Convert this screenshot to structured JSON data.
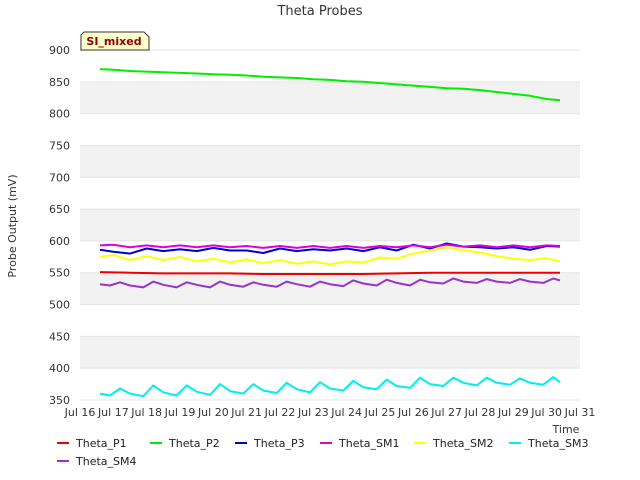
{
  "chart_data": {
    "type": "line",
    "title": "Theta Probes",
    "xlabel": "Time",
    "ylabel": "Probe Output (mV)",
    "badge": "SI_mixed",
    "ylim": [
      350,
      900
    ],
    "yticks": [
      350,
      400,
      450,
      500,
      550,
      600,
      650,
      700,
      750,
      800,
      850,
      900
    ],
    "xlim": [
      16,
      31
    ],
    "xticks": [
      16,
      17,
      18,
      19,
      20,
      21,
      22,
      23,
      24,
      25,
      26,
      27,
      28,
      29,
      30,
      31
    ],
    "xtick_labels": [
      "Jul 16",
      "Jul 17",
      "Jul 18",
      "Jul 19",
      "Jul 20",
      "Jul 21",
      "Jul 22",
      "Jul 23",
      "Jul 24",
      "Jul 25",
      "Jul 26",
      "Jul 27",
      "Jul 28",
      "Jul 29",
      "Jul 30",
      "Jul 31"
    ],
    "grid": "horizontal bands",
    "legend_position": "bottom",
    "series": [
      {
        "name": "Theta_P1",
        "color": "#ee0000",
        "x": [
          16.6,
          17.5,
          18.5,
          19.5,
          20.5,
          21.5,
          22.5,
          23.5,
          24.5,
          25.5,
          26.5,
          27.5,
          28.5,
          29.5,
          30.4
        ],
        "y": [
          551,
          550,
          549,
          549,
          549,
          548,
          548,
          548,
          548,
          549,
          550,
          550,
          550,
          550,
          550
        ]
      },
      {
        "name": "Theta_P2",
        "color": "#00ee00",
        "x": [
          16.6,
          17.0,
          17.5,
          18.0,
          18.5,
          19.0,
          19.5,
          20.0,
          20.5,
          21.0,
          21.5,
          22.0,
          22.5,
          23.0,
          23.5,
          24.0,
          24.5,
          25.0,
          25.5,
          26.0,
          26.5,
          27.0,
          27.5,
          28.0,
          28.5,
          29.0,
          29.5,
          30.0,
          30.4
        ],
        "y": [
          870,
          869,
          867,
          866,
          865,
          864,
          863,
          862,
          861,
          860,
          858,
          857,
          856,
          854,
          853,
          851,
          850,
          848,
          846,
          844,
          842,
          840,
          839,
          837,
          834,
          831,
          828,
          823,
          821
        ]
      },
      {
        "name": "Theta_P3",
        "color": "#0000cc",
        "x": [
          16.6,
          17.0,
          17.5,
          18.0,
          18.5,
          19.0,
          19.5,
          20.0,
          20.5,
          21.0,
          21.5,
          22.0,
          22.5,
          23.0,
          23.5,
          24.0,
          24.5,
          25.0,
          25.5,
          26.0,
          26.5,
          27.0,
          27.5,
          28.0,
          28.5,
          29.0,
          29.5,
          30.0,
          30.4
        ],
        "y": [
          586,
          583,
          580,
          588,
          584,
          587,
          584,
          589,
          585,
          585,
          581,
          588,
          584,
          587,
          585,
          588,
          584,
          590,
          585,
          594,
          588,
          596,
          591,
          590,
          588,
          590,
          586,
          592,
          591
        ]
      },
      {
        "name": "Theta_SM1",
        "color": "#dd00dd",
        "x": [
          16.6,
          17.0,
          17.5,
          18.0,
          18.5,
          19.0,
          19.5,
          20.0,
          20.5,
          21.0,
          21.5,
          22.0,
          22.5,
          23.0,
          23.5,
          24.0,
          24.5,
          25.0,
          25.5,
          26.0,
          26.5,
          27.0,
          27.5,
          28.0,
          28.5,
          29.0,
          29.5,
          30.0,
          30.4
        ],
        "y": [
          593,
          594,
          590,
          593,
          590,
          593,
          590,
          593,
          590,
          592,
          589,
          592,
          589,
          592,
          589,
          592,
          589,
          592,
          590,
          593,
          590,
          594,
          591,
          593,
          590,
          593,
          590,
          593,
          592
        ]
      },
      {
        "name": "Theta_SM2",
        "color": "#ffff00",
        "x": [
          16.6,
          17.0,
          17.5,
          18.0,
          18.5,
          19.0,
          19.5,
          20.0,
          20.5,
          21.0,
          21.5,
          22.0,
          22.5,
          23.0,
          23.5,
          24.0,
          24.5,
          25.0,
          25.5,
          26.0,
          26.5,
          27.0,
          27.5,
          28.0,
          28.5,
          29.0,
          29.5,
          30.0,
          30.4
        ],
        "y": [
          575,
          578,
          570,
          576,
          570,
          575,
          568,
          572,
          566,
          571,
          565,
          570,
          564,
          568,
          563,
          568,
          566,
          574,
          572,
          580,
          585,
          590,
          585,
          582,
          576,
          572,
          570,
          573,
          568
        ]
      },
      {
        "name": "Theta_SM3",
        "color": "#00eeee",
        "x": [
          16.6,
          16.9,
          17.2,
          17.5,
          17.9,
          18.2,
          18.5,
          18.9,
          19.2,
          19.5,
          19.9,
          20.2,
          20.5,
          20.9,
          21.2,
          21.5,
          21.9,
          22.2,
          22.5,
          22.9,
          23.2,
          23.5,
          23.9,
          24.2,
          24.5,
          24.9,
          25.2,
          25.5,
          25.9,
          26.2,
          26.5,
          26.9,
          27.2,
          27.5,
          27.9,
          28.2,
          28.5,
          28.9,
          29.2,
          29.5,
          29.9,
          30.2,
          30.4
        ],
        "y": [
          360,
          357,
          368,
          360,
          356,
          373,
          362,
          357,
          373,
          363,
          358,
          375,
          364,
          360,
          375,
          365,
          361,
          377,
          367,
          362,
          378,
          368,
          365,
          380,
          370,
          367,
          382,
          372,
          369,
          385,
          375,
          372,
          385,
          377,
          373,
          385,
          377,
          374,
          384,
          377,
          374,
          386,
          378
        ]
      },
      {
        "name": "Theta_SM4",
        "color": "#9933cc",
        "x": [
          16.6,
          16.9,
          17.2,
          17.5,
          17.9,
          18.2,
          18.5,
          18.9,
          19.2,
          19.5,
          19.9,
          20.2,
          20.5,
          20.9,
          21.2,
          21.5,
          21.9,
          22.2,
          22.5,
          22.9,
          23.2,
          23.5,
          23.9,
          24.2,
          24.5,
          24.9,
          25.2,
          25.5,
          25.9,
          26.2,
          26.5,
          26.9,
          27.2,
          27.5,
          27.9,
          28.2,
          28.5,
          28.9,
          29.2,
          29.5,
          29.9,
          30.2,
          30.4
        ],
        "y": [
          532,
          530,
          535,
          530,
          527,
          536,
          531,
          527,
          535,
          531,
          527,
          536,
          531,
          528,
          535,
          531,
          528,
          536,
          532,
          528,
          536,
          532,
          529,
          538,
          533,
          530,
          539,
          534,
          530,
          539,
          535,
          533,
          541,
          536,
          534,
          540,
          536,
          534,
          540,
          536,
          534,
          541,
          538
        ]
      }
    ]
  }
}
